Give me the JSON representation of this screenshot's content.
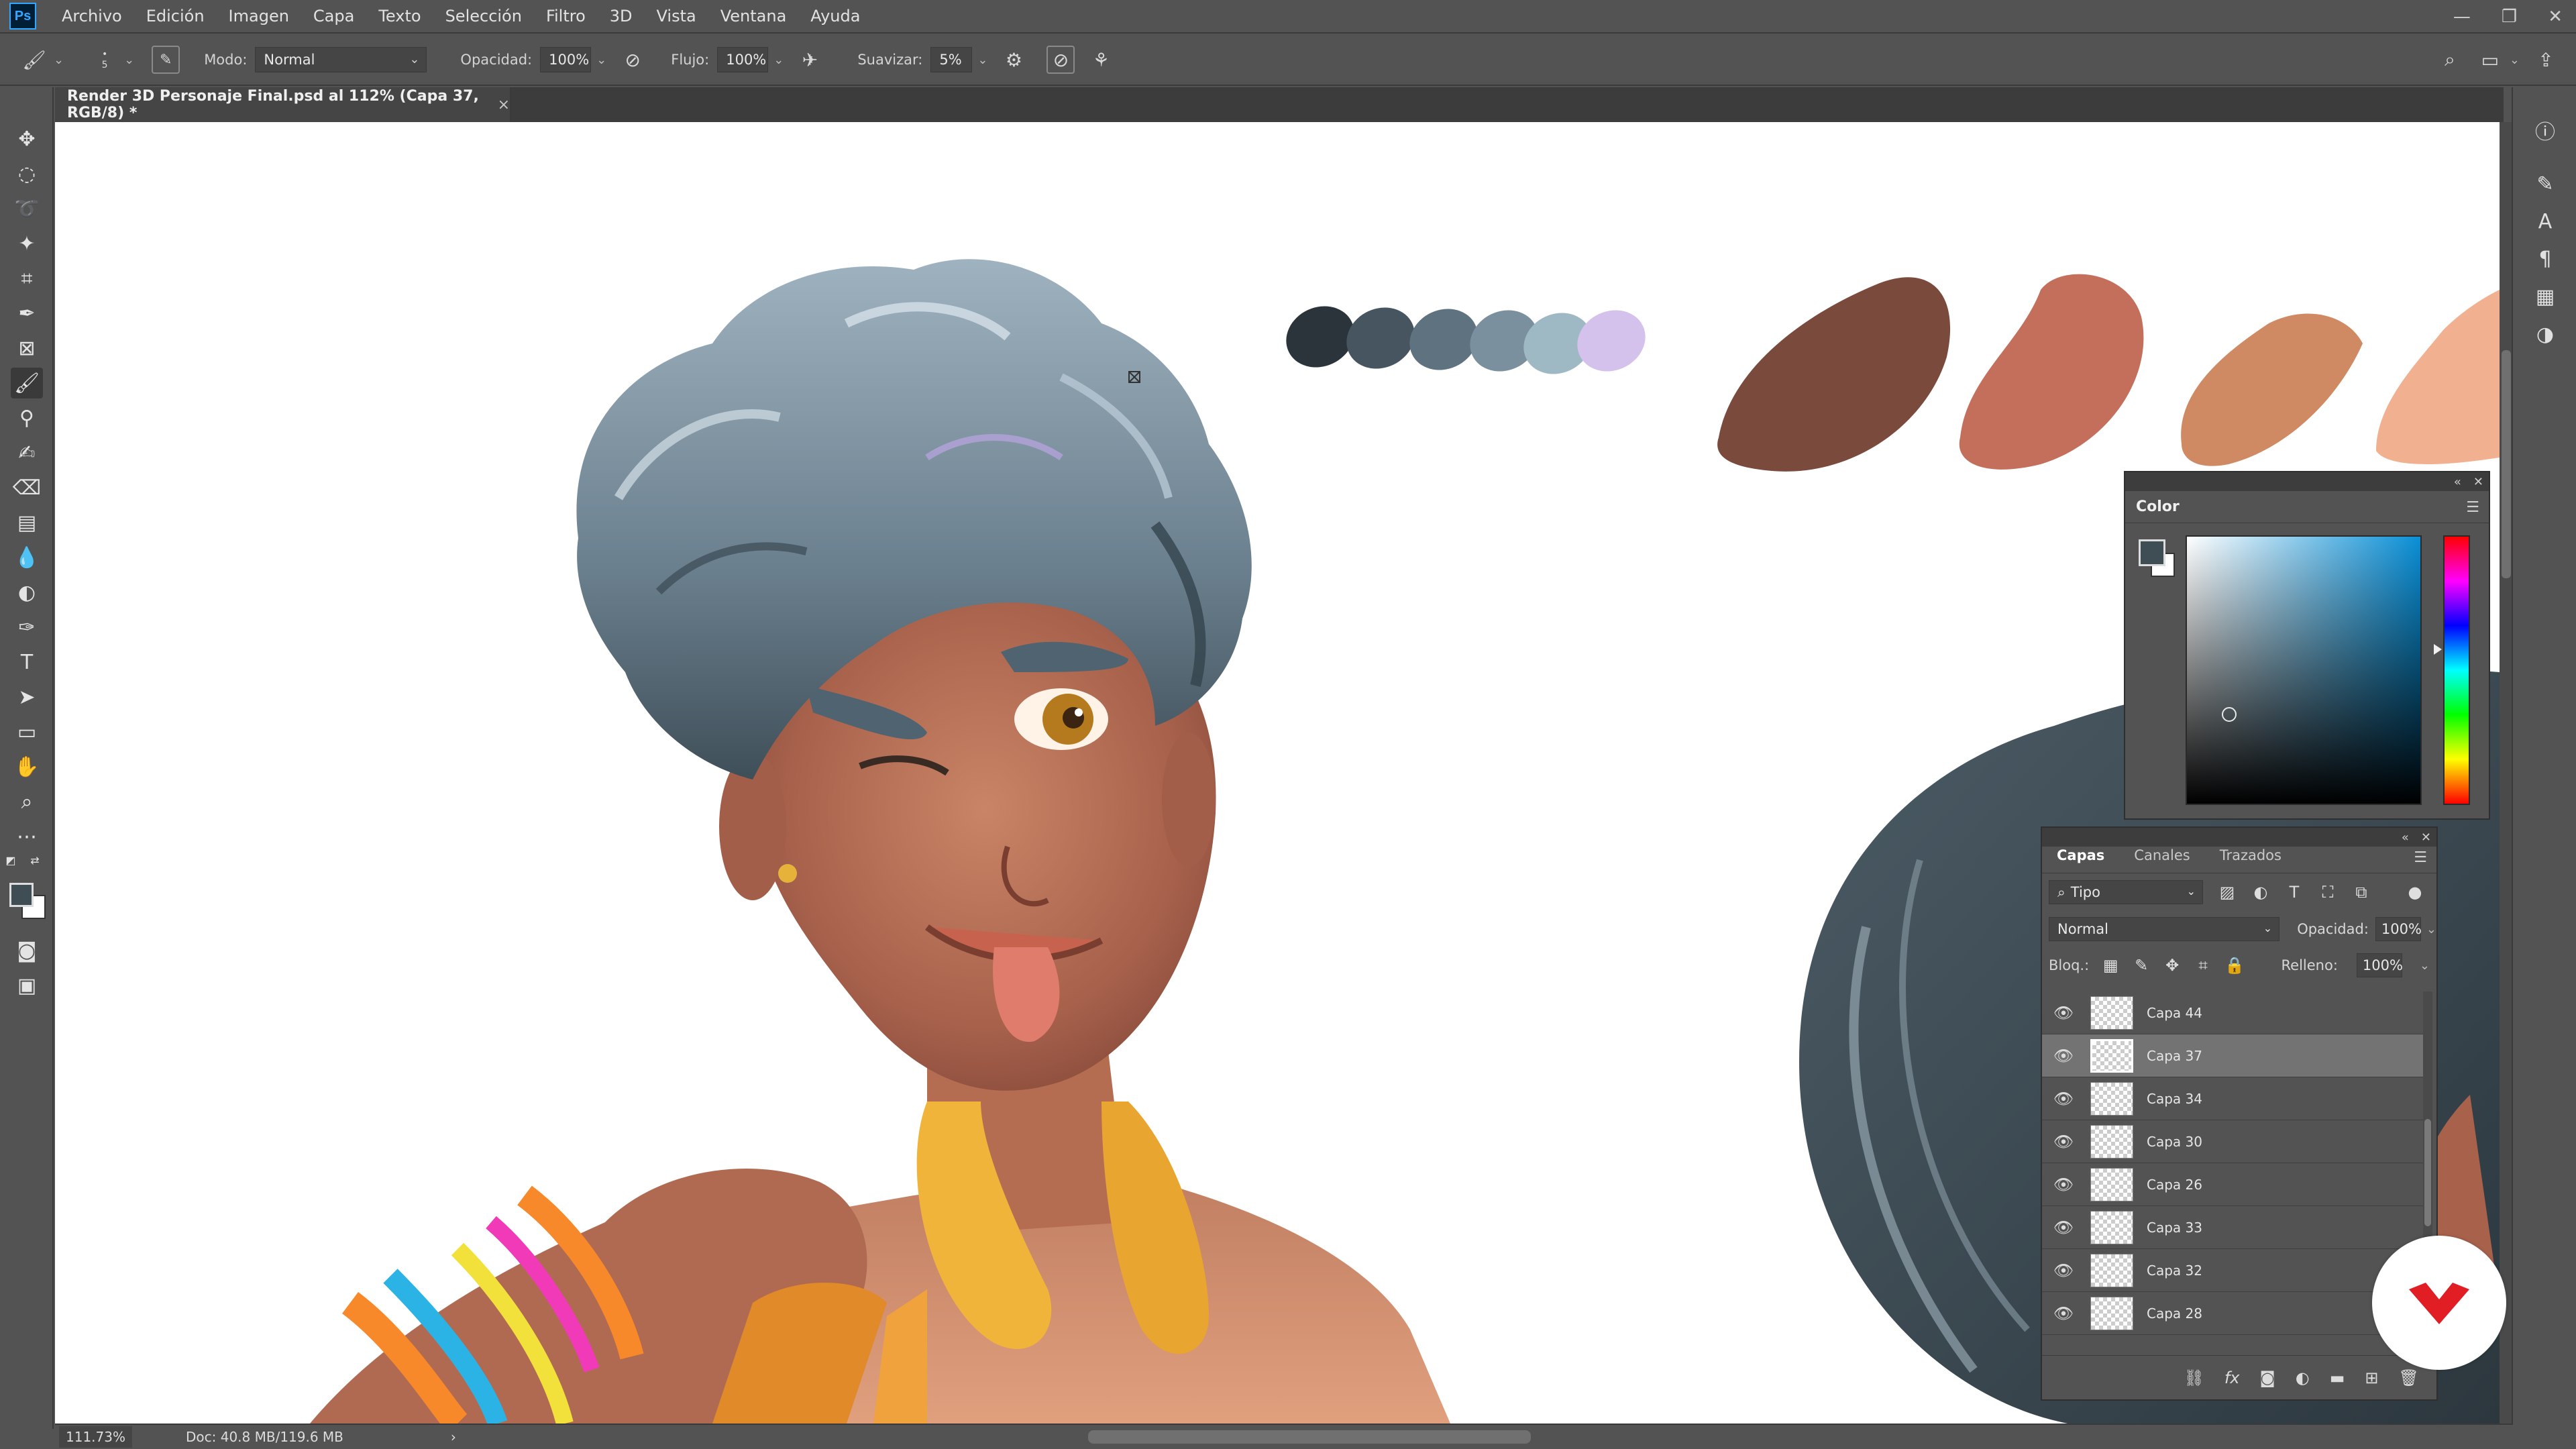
{
  "menu": {
    "logo": "Ps",
    "items": [
      "Archivo",
      "Edición",
      "Imagen",
      "Capa",
      "Texto",
      "Selección",
      "Filtro",
      "3D",
      "Vista",
      "Ventana",
      "Ayuda"
    ]
  },
  "options_bar": {
    "brush_size": "5",
    "mode_label": "Modo:",
    "mode_value": "Normal",
    "opacity_label": "Opacidad:",
    "opacity_value": "100%",
    "flow_label": "Flujo:",
    "flow_value": "100%",
    "smoothing_label": "Suavizar:",
    "smoothing_value": "5%"
  },
  "document": {
    "tab_title": "Render 3D Personaje Final.psd al 112% (Capa 37, RGB/8) *",
    "close": "×"
  },
  "status": {
    "zoom": "111.73%",
    "doc_size": "Doc: 40.8 MB/119.6 MB"
  },
  "color_panel": {
    "title": "Color",
    "foreground_color": "#3f4d55",
    "background_color": "#ffffff",
    "hue_color": "#0a8fd6"
  },
  "layers_panel": {
    "tabs": [
      "Capas",
      "Canales",
      "Trazados"
    ],
    "active_tab": "Capas",
    "filter_kind": "Tipo",
    "blend_mode": "Normal",
    "opacity_label": "Opacidad:",
    "opacity_value": "100%",
    "lock_label": "Bloq.:",
    "fill_label": "Relleno:",
    "fill_value": "100%",
    "layers": [
      {
        "name": "Capa 44",
        "selected": false
      },
      {
        "name": "Capa 37",
        "selected": true
      },
      {
        "name": "Capa 34",
        "selected": false
      },
      {
        "name": "Capa 30",
        "selected": false
      },
      {
        "name": "Capa 26",
        "selected": false
      },
      {
        "name": "Capa 33",
        "selected": false
      },
      {
        "name": "Capa 32",
        "selected": false
      },
      {
        "name": "Capa 28",
        "selected": false
      }
    ]
  },
  "palette": {
    "hair_swatches": [
      "#2b343b",
      "#46555f",
      "#5f7280",
      "#7a909e",
      "#9fb9c4",
      "#d5c2ec"
    ],
    "skin_swatches": [
      "#7a4a3c",
      "#c46f5b",
      "#d08a63",
      "#f1b08f"
    ]
  },
  "colors": {
    "ui_background": "#535353",
    "panel_dark": "#3a3a3a",
    "canvas": "#ffffff",
    "accent_ps": "#31a8ff",
    "brand_red": "#e01e24"
  }
}
